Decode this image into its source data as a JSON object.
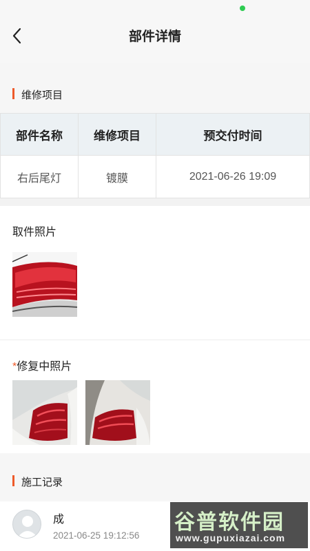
{
  "header": {
    "title": "部件详情"
  },
  "repair_section": {
    "title": "维修项目",
    "columns": [
      "部件名称",
      "维修项目",
      "预交付时间"
    ],
    "rows": [
      [
        "右后尾灯",
        "镀膜",
        "2021-06-26 19:09"
      ]
    ]
  },
  "pickup_photos": {
    "title": "取件照片",
    "count": 1
  },
  "repair_photos": {
    "required_mark": "*",
    "title": "修复中照片",
    "count": 2
  },
  "construction": {
    "title": "施工记录",
    "records": [
      {
        "name": "成",
        "time": "2021-06-25 19:12:56"
      }
    ]
  },
  "watermark": {
    "main": "谷普软件园",
    "sub": "www.gupuxiazai.com"
  },
  "colors": {
    "accent": "#ee5a2a",
    "status_dot": "#2ecc52",
    "table_header_bg": "#ecf1f4"
  },
  "icons": {
    "back": "chevron-left-icon",
    "avatar": "user-avatar-icon"
  }
}
